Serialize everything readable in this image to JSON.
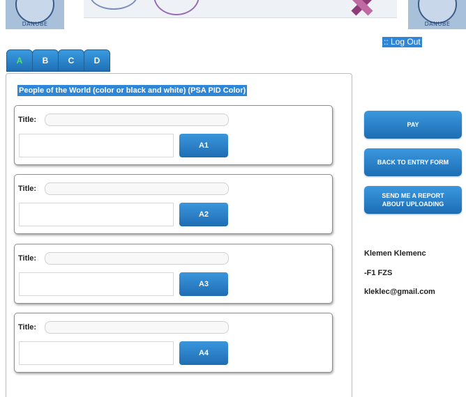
{
  "header": {
    "logo_text": "DANUBE",
    "logout_label": ":: Log Out"
  },
  "tabs": [
    {
      "label": "A",
      "active": true
    },
    {
      "label": "B",
      "active": false
    },
    {
      "label": "C",
      "active": false
    },
    {
      "label": "D",
      "active": false
    }
  ],
  "section": {
    "category_title": "People of the World (color or black and white) (PSA PID Color)",
    "entries": [
      {
        "title_label": "Title:",
        "title_value": "",
        "upload_label": "A1"
      },
      {
        "title_label": "Title:",
        "title_value": "",
        "upload_label": "A2"
      },
      {
        "title_label": "Title:",
        "title_value": "",
        "upload_label": "A3"
      },
      {
        "title_label": "Title:",
        "title_value": "",
        "upload_label": "A4"
      }
    ]
  },
  "actions": {
    "pay_label": "PAY",
    "back_label": "BACK TO ENTRY FORM",
    "report_label": "SEND ME A REPORT ABOUT UPLOADING"
  },
  "user": {
    "name": "Klemen Klemenc",
    "distinction": "-F1 FZS",
    "email": "kleklec@gmail.com"
  },
  "colors": {
    "accent": "#2f86d6",
    "active_tab_text": "#55e070",
    "button_gradient_top": "#3a96dc",
    "button_gradient_bottom": "#1f6db3"
  }
}
